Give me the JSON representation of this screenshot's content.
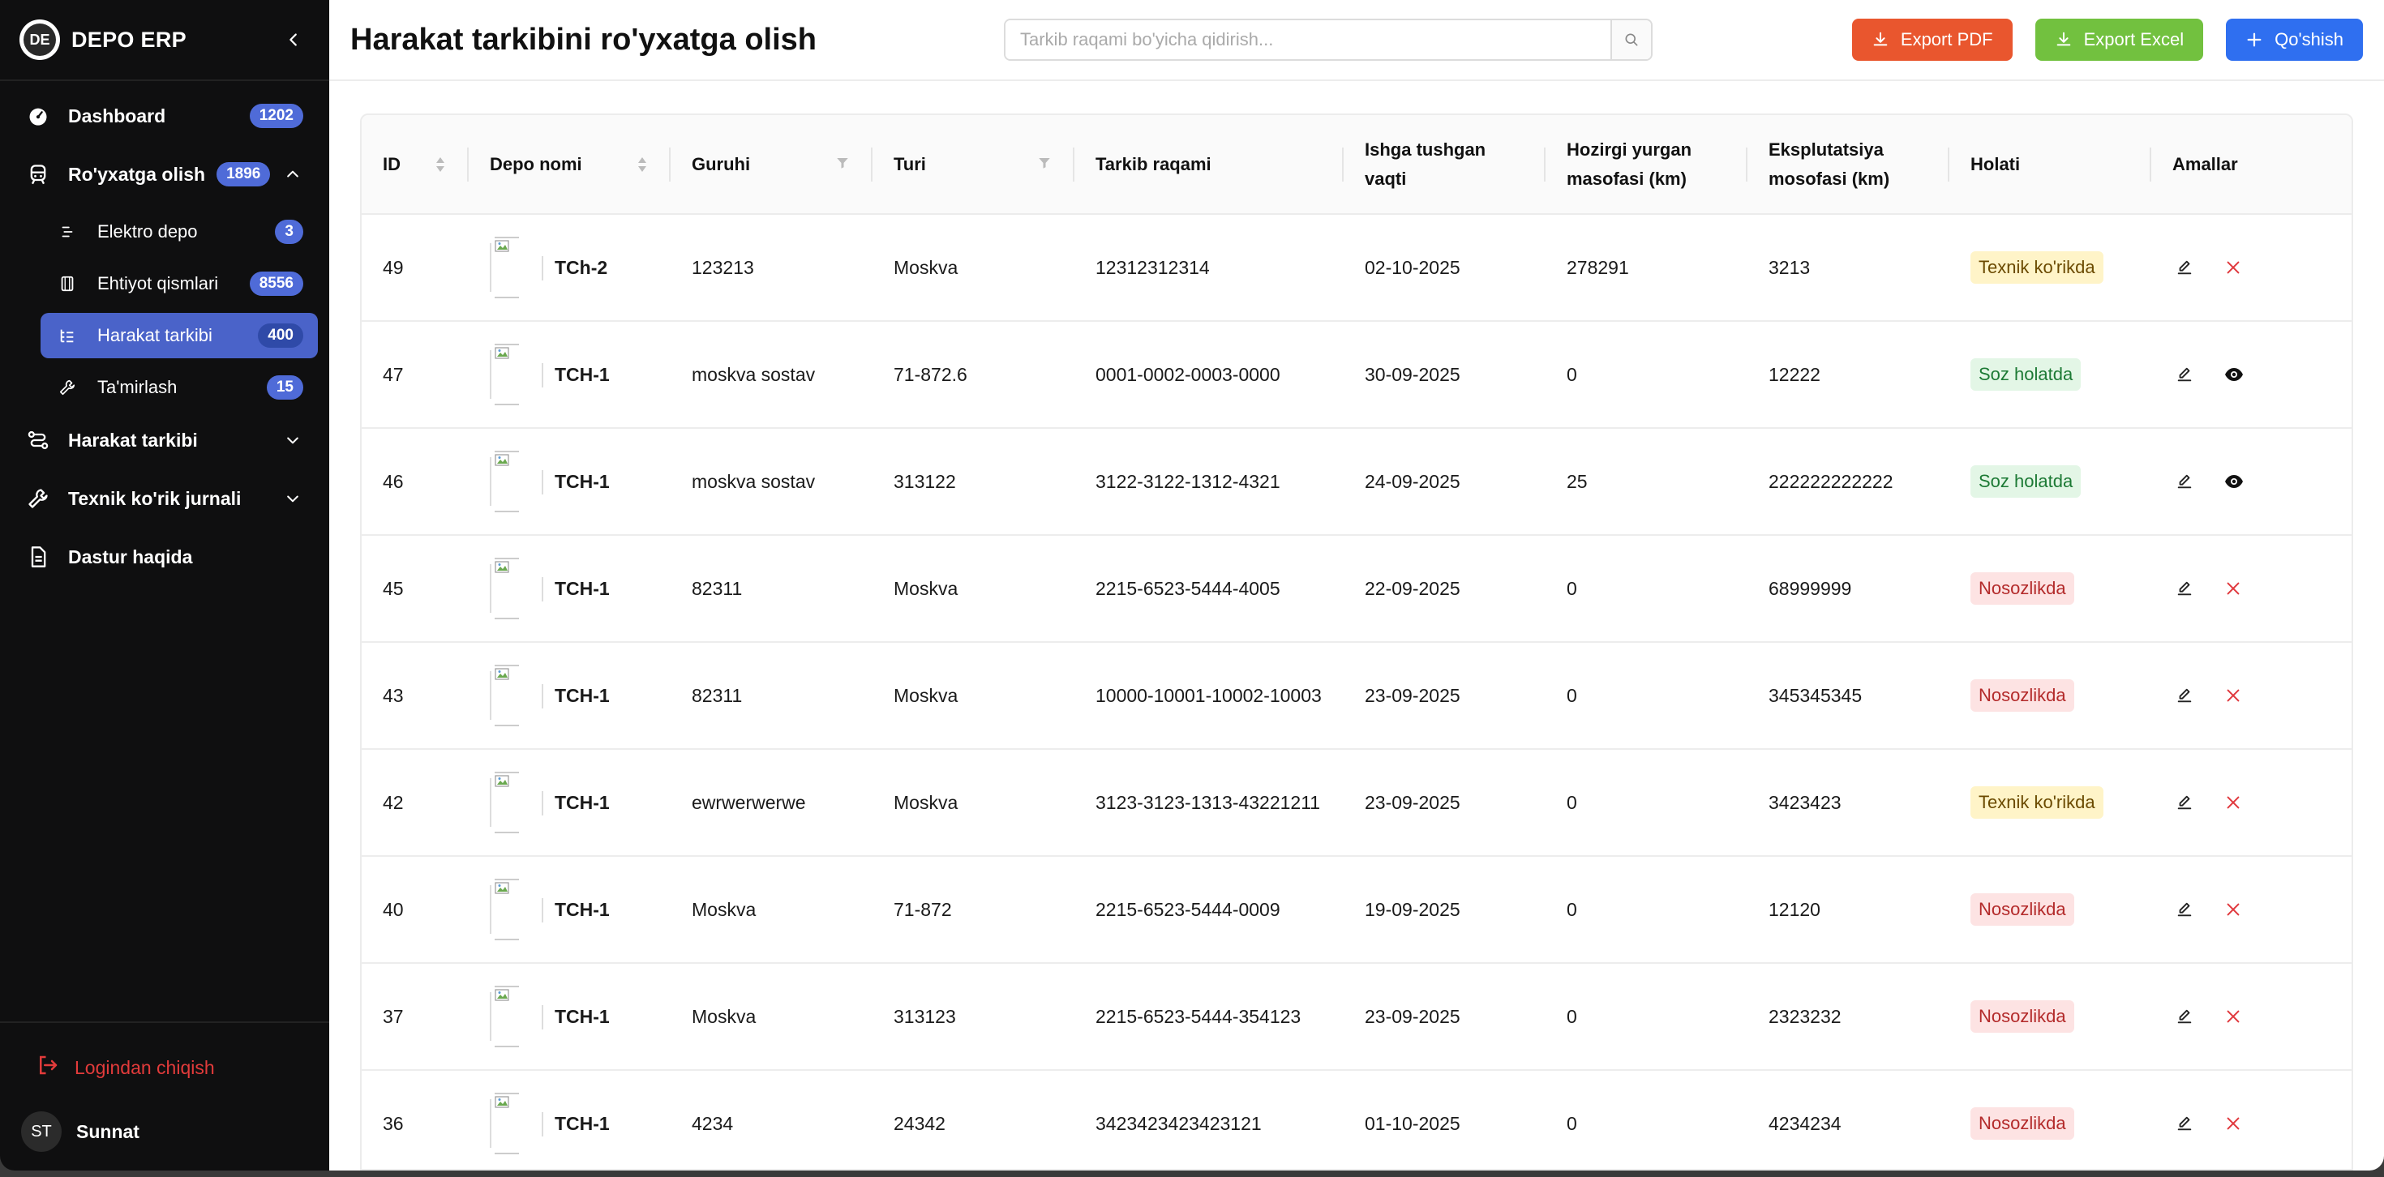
{
  "brand": {
    "title": "DEPO ERP",
    "logo_text": "DE"
  },
  "sidebar": {
    "items": [
      {
        "label": "Dashboard",
        "badge": "1202"
      },
      {
        "label": "Ro'yxatga olish",
        "badge": "1896"
      },
      {
        "label": "Harakat tarkibi"
      },
      {
        "label": "Texnik ko'rik jurnali"
      },
      {
        "label": "Dastur haqida"
      }
    ],
    "sub_items": [
      {
        "label": "Elektro depo",
        "badge": "3"
      },
      {
        "label": "Ehtiyot qismlari",
        "badge": "8556"
      },
      {
        "label": "Harakat tarkibi",
        "badge": "400"
      },
      {
        "label": "Ta'mirlash",
        "badge": "15"
      }
    ],
    "logout_label": "Logindan chiqish",
    "user": {
      "initials": "ST",
      "name": "Sunnat"
    }
  },
  "header": {
    "title": "Harakat tarkibini ro'yxatga olish",
    "search_placeholder": "Tarkib raqami bo'yicha qidirish...",
    "export_pdf": "Export PDF",
    "export_excel": "Export Excel",
    "add": "Qo'shish"
  },
  "table": {
    "columns": [
      "ID",
      "Depo nomi",
      "Guruhi",
      "Turi",
      "Tarkib raqami",
      "Ishga tushgan vaqti",
      "Hozirgi yurgan masofasi (km)",
      "Eksplutatsiya mosofasi (km)",
      "Holati",
      "Amallar"
    ],
    "rows": [
      {
        "id": "49",
        "depo": "TCh-2",
        "group": "123213",
        "type": "Moskva",
        "number": "12312312314",
        "date": "02-10-2025",
        "current": "278291",
        "exploit": "3213",
        "status": "Texnik ko'rikda",
        "status_kind": "yellow",
        "action2": "delete"
      },
      {
        "id": "47",
        "depo": "TCH-1",
        "group": "moskva sostav",
        "type": "71-872.6",
        "number": "0001-0002-0003-0000",
        "date": "30-09-2025",
        "current": "0",
        "exploit": "12222",
        "status": "Soz holatda",
        "status_kind": "green",
        "action2": "view"
      },
      {
        "id": "46",
        "depo": "TCH-1",
        "group": "moskva sostav",
        "type": "313122",
        "number": "3122-3122-1312-4321",
        "date": "24-09-2025",
        "current": "25",
        "exploit": "222222222222",
        "status": "Soz holatda",
        "status_kind": "green",
        "action2": "view"
      },
      {
        "id": "45",
        "depo": "TCH-1",
        "group": "82311",
        "type": "Moskva",
        "number": "2215-6523-5444-4005",
        "date": "22-09-2025",
        "current": "0",
        "exploit": "68999999",
        "status": "Nosozlikda",
        "status_kind": "red",
        "action2": "delete"
      },
      {
        "id": "43",
        "depo": "TCH-1",
        "group": "82311",
        "type": "Moskva",
        "number": "10000-10001-10002-10003",
        "date": "23-09-2025",
        "current": "0",
        "exploit": "345345345",
        "status": "Nosozlikda",
        "status_kind": "red",
        "action2": "delete"
      },
      {
        "id": "42",
        "depo": "TCH-1",
        "group": "ewrwerwerwe",
        "type": "Moskva",
        "number": "3123-3123-1313-43221211",
        "date": "23-09-2025",
        "current": "0",
        "exploit": "3423423",
        "status": "Texnik ko'rikda",
        "status_kind": "yellow",
        "action2": "delete"
      },
      {
        "id": "40",
        "depo": "TCH-1",
        "group": "Moskva",
        "type": "71-872",
        "number": "2215-6523-5444-0009",
        "date": "19-09-2025",
        "current": "0",
        "exploit": "12120",
        "status": "Nosozlikda",
        "status_kind": "red",
        "action2": "delete"
      },
      {
        "id": "37",
        "depo": "TCH-1",
        "group": "Moskva",
        "type": "313123",
        "number": "2215-6523-5444-354123",
        "date": "23-09-2025",
        "current": "0",
        "exploit": "2323232",
        "status": "Nosozlikda",
        "status_kind": "red",
        "action2": "delete"
      },
      {
        "id": "36",
        "depo": "TCH-1",
        "group": "4234",
        "type": "24342",
        "number": "3423423423423121",
        "date": "01-10-2025",
        "current": "0",
        "exploit": "4234234",
        "status": "Nosozlikda",
        "status_kind": "red",
        "action2": "delete"
      }
    ]
  }
}
